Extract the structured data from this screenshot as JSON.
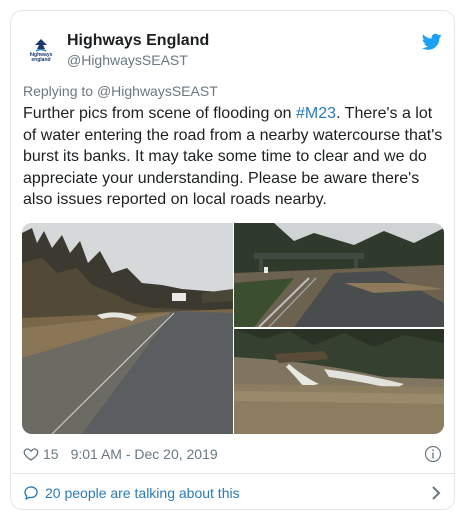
{
  "author": {
    "display_name": "Highways England",
    "handle": "@HighwaysSEAST",
    "avatar_text": "highways england"
  },
  "reply": {
    "prefix": "Replying to ",
    "mention": "@HighwaysSEAST"
  },
  "tweet": {
    "text_before": "Further pics from scene of flooding on ",
    "hashtag": "#M23",
    "text_after": ". There's a lot of water entering the road from a nearby watercourse that's burst its banks. It may take some time to clear and we do appreciate your understanding. Please be aware there's also issues reported on local roads nearby."
  },
  "media": {
    "photos": [
      "flooded-road-photo",
      "flooded-motorway-bridge-photo",
      "burst-watercourse-photo"
    ]
  },
  "meta": {
    "likes": "15",
    "timestamp": "9:01 AM - Dec 20, 2019"
  },
  "footer": {
    "talking_label": "20 people are talking about this"
  },
  "colors": {
    "link": "#2b7bb9",
    "twitter_blue": "#1da1f2",
    "muted": "#697882"
  }
}
